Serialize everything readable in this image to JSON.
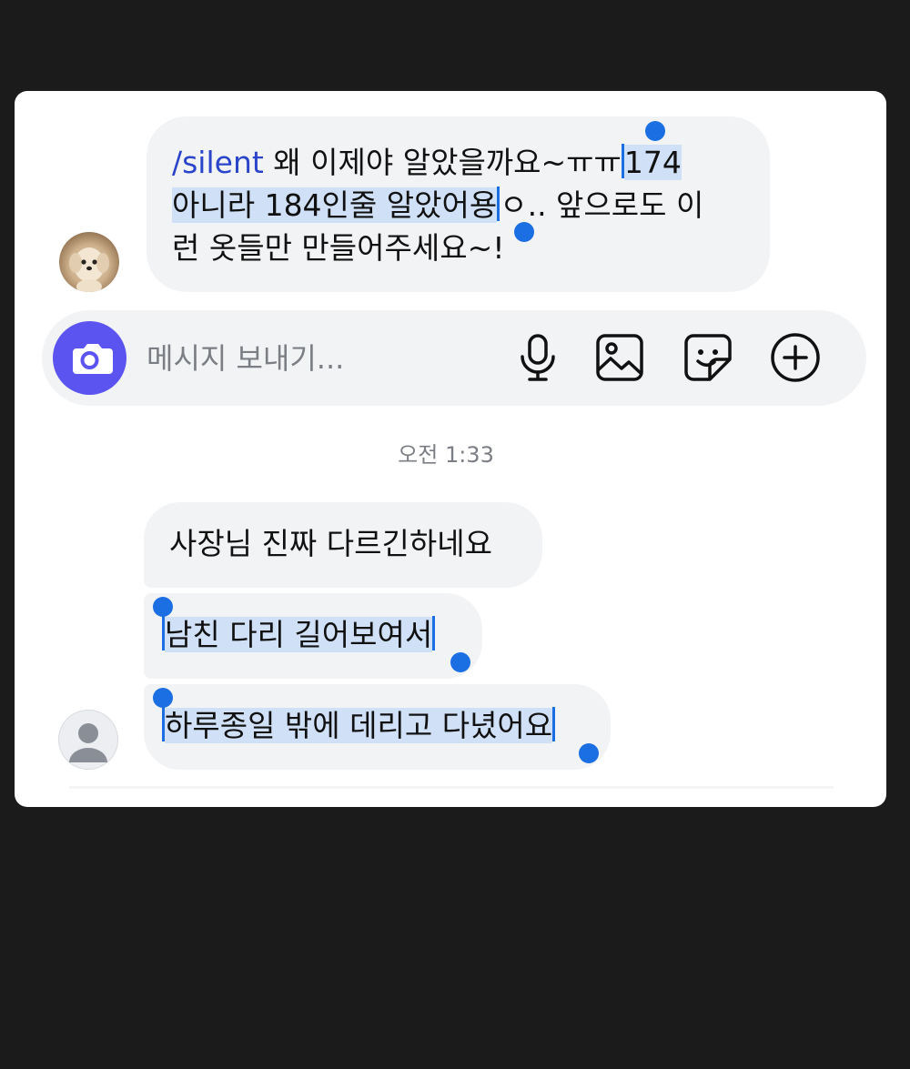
{
  "conversation": {
    "messages": [
      {
        "command": "/silent",
        "line1_plain": " 왜 이제야 알았을까요~ㅠㅠ",
        "line1_highlight": "174",
        "line2_highlight": "아니라 184인줄 알았어용",
        "line2_plain": "ㅇ.. 앞으로도 이",
        "line3": "런 옷들만 만들어주세요~!"
      }
    ],
    "timestamp": "오전 1:33",
    "replies": [
      {
        "text": "사장님 진짜 다르긴하네요"
      },
      {
        "text": "남친 다리 길어보여서"
      },
      {
        "text": "하루종일 밖에 데리고 다녔어요"
      }
    ]
  },
  "composer": {
    "placeholder": "메시지 보내기...",
    "camera_icon": "camera-icon",
    "mic_icon": "microphone-icon",
    "gallery_icon": "image-icon",
    "sticker_icon": "sticker-icon",
    "plus_icon": "plus-circle-icon"
  },
  "colors": {
    "accent": "#5b54f0",
    "selection": "#cfe0f7",
    "selection_handle": "#1b6fe3",
    "command": "#2a45c9",
    "bubble": "#f2f3f5"
  }
}
